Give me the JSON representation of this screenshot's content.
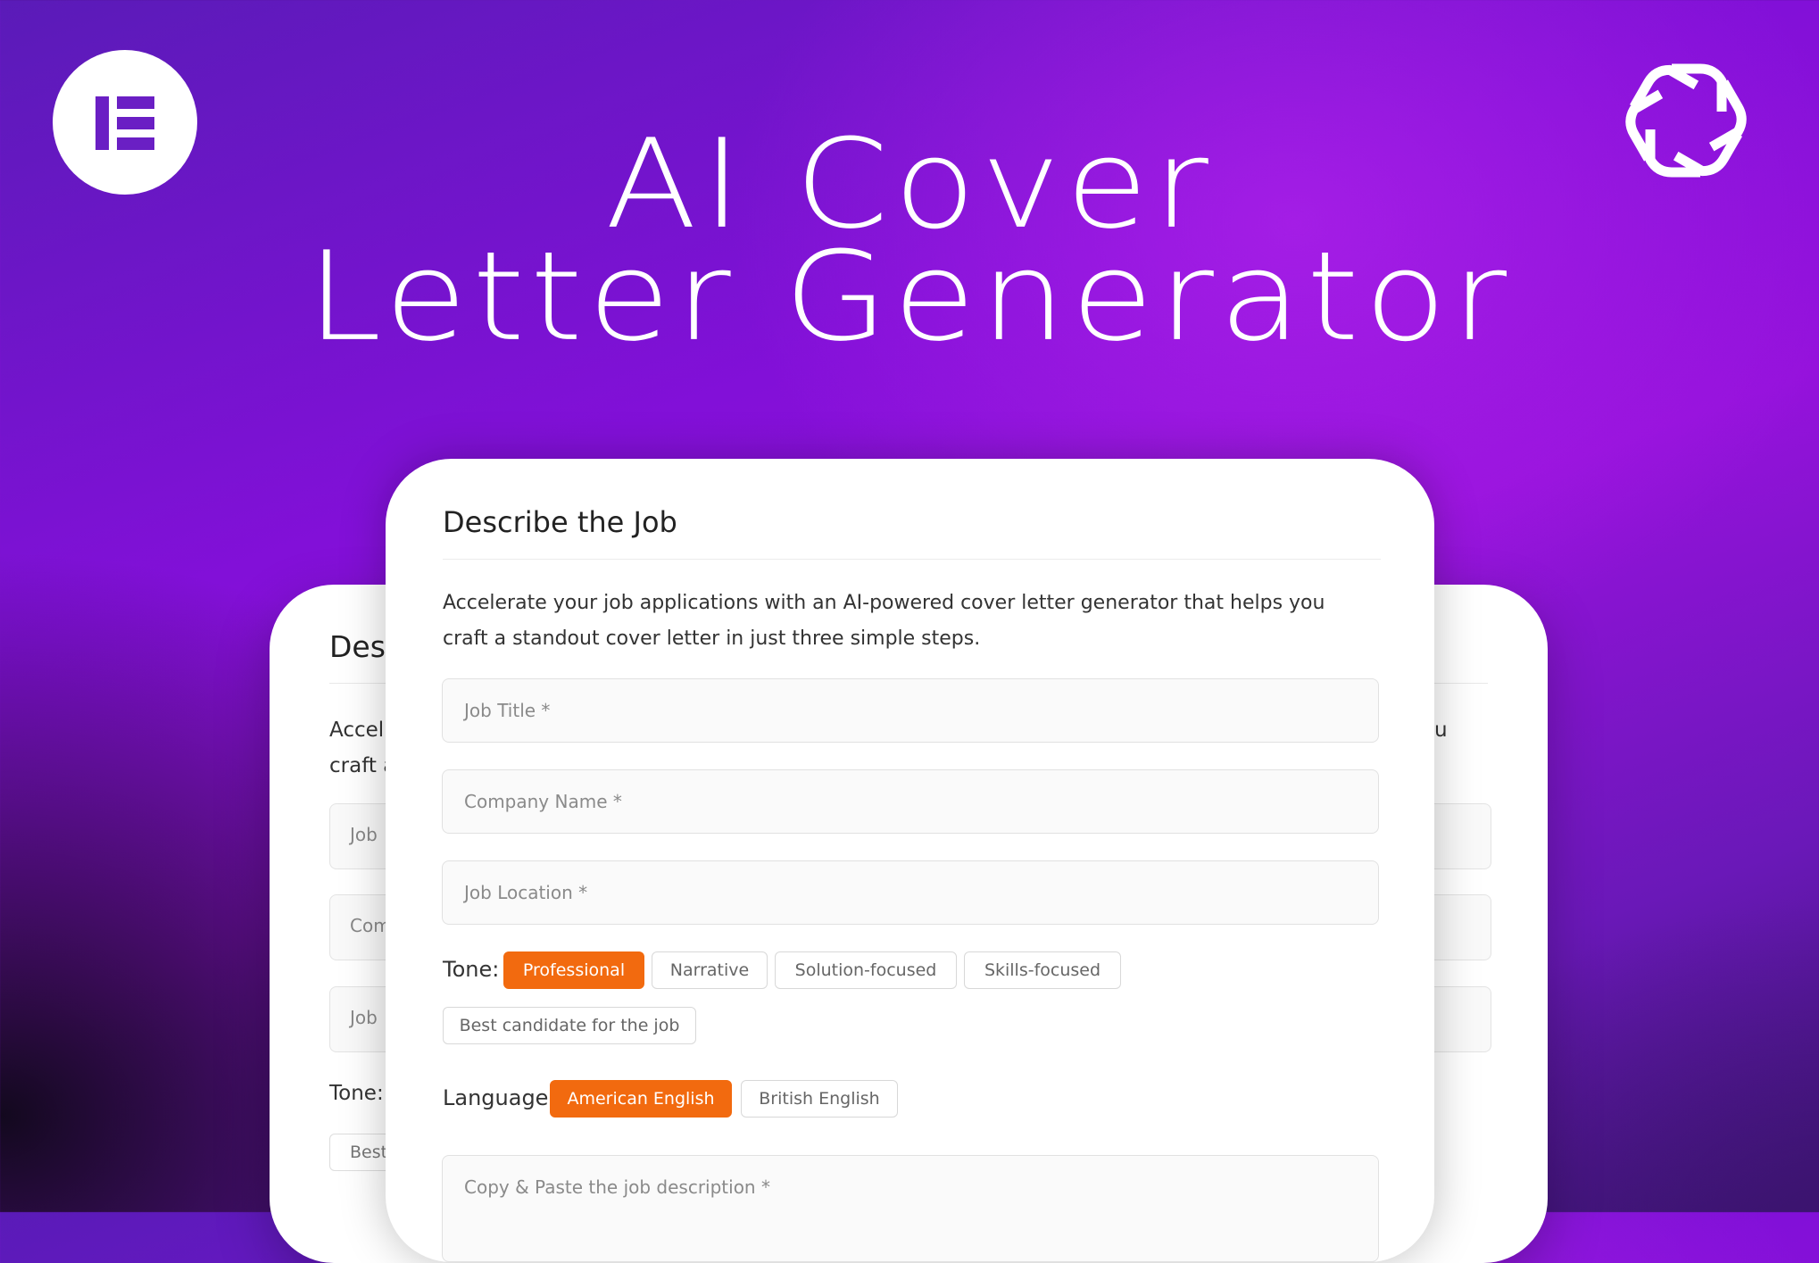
{
  "headline": {
    "line1": "AI Cover",
    "line2": "Letter Generator"
  },
  "icons": {
    "left_logo": "elementor-logo-icon",
    "right_logo": "openai-logo-icon"
  },
  "colors": {
    "accent": "#f26a0f",
    "logo_purple": "#6a1fc4"
  },
  "form": {
    "title": "Describe the Job",
    "description_line1": "Accelerate your job applications with an AI-powered cover letter generator that helps you",
    "description_line2": "craft a standout cover letter in just three simple steps.",
    "fields": {
      "job_title": "Job Title *",
      "company_name": "Company Name *",
      "job_location": "Job Location *",
      "job_description": "Copy & Paste the job description *"
    },
    "tone": {
      "label": "Tone:",
      "options": [
        "Professional",
        "Narrative",
        "Solution-focused",
        "Skills-focused",
        "Best candidate for the job"
      ],
      "selected": "Professional"
    },
    "language": {
      "label": "Language:",
      "options": [
        "American English",
        "British English"
      ],
      "selected": "American English"
    }
  },
  "back_card": {
    "title": "Desc",
    "text_line1": "Accel",
    "text_line2": "craft a",
    "text_right": "u",
    "field1": "Job",
    "field2": "Com",
    "field3": "Job",
    "tone": "Tone:",
    "chip": "Best"
  }
}
